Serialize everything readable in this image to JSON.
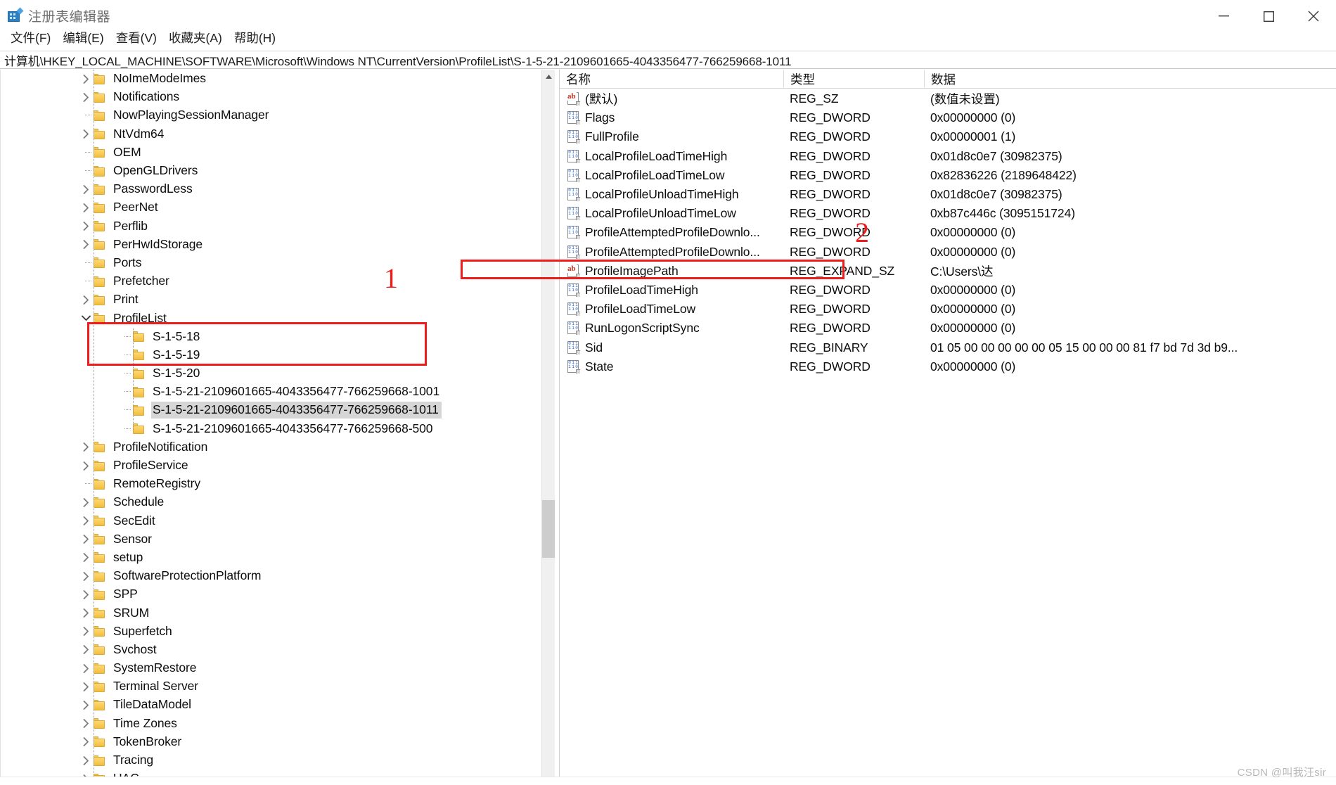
{
  "window": {
    "title": "注册表编辑器",
    "icon": "registry-editor-icon",
    "minimize_label": "—",
    "maximize_label": "□",
    "close_label": "✕"
  },
  "menu": {
    "items": [
      {
        "label": "文件(F)"
      },
      {
        "label": "编辑(E)"
      },
      {
        "label": "查看(V)"
      },
      {
        "label": "收藏夹(A)"
      },
      {
        "label": "帮助(H)"
      }
    ]
  },
  "address": {
    "path": "计算机\\HKEY_LOCAL_MACHINE\\SOFTWARE\\Microsoft\\Windows NT\\CurrentVersion\\ProfileList\\S-1-5-21-2109601665-4043356477-766259668-1011"
  },
  "tree": {
    "items": [
      {
        "label": "NoImeModeImes",
        "indent": 1,
        "expander": "collapsed",
        "selected": false
      },
      {
        "label": "Notifications",
        "indent": 1,
        "expander": "collapsed",
        "selected": false
      },
      {
        "label": "NowPlayingSessionManager",
        "indent": 1,
        "expander": "none",
        "selected": false
      },
      {
        "label": "NtVdm64",
        "indent": 1,
        "expander": "collapsed",
        "selected": false
      },
      {
        "label": "OEM",
        "indent": 1,
        "expander": "none",
        "selected": false
      },
      {
        "label": "OpenGLDrivers",
        "indent": 1,
        "expander": "none",
        "selected": false
      },
      {
        "label": "PasswordLess",
        "indent": 1,
        "expander": "collapsed",
        "selected": false
      },
      {
        "label": "PeerNet",
        "indent": 1,
        "expander": "collapsed",
        "selected": false
      },
      {
        "label": "Perflib",
        "indent": 1,
        "expander": "collapsed",
        "selected": false
      },
      {
        "label": "PerHwIdStorage",
        "indent": 1,
        "expander": "collapsed",
        "selected": false
      },
      {
        "label": "Ports",
        "indent": 1,
        "expander": "none",
        "selected": false
      },
      {
        "label": "Prefetcher",
        "indent": 1,
        "expander": "none",
        "selected": false
      },
      {
        "label": "Print",
        "indent": 1,
        "expander": "collapsed",
        "selected": false
      },
      {
        "label": "ProfileList",
        "indent": 1,
        "expander": "expanded",
        "selected": false
      },
      {
        "label": "S-1-5-18",
        "indent": 2,
        "expander": "none",
        "selected": false
      },
      {
        "label": "S-1-5-19",
        "indent": 2,
        "expander": "none",
        "selected": false
      },
      {
        "label": "S-1-5-20",
        "indent": 2,
        "expander": "none",
        "selected": false
      },
      {
        "label": "S-1-5-21-2109601665-4043356477-766259668-1001",
        "indent": 2,
        "expander": "none",
        "selected": false
      },
      {
        "label": "S-1-5-21-2109601665-4043356477-766259668-1011",
        "indent": 2,
        "expander": "none",
        "selected": true
      },
      {
        "label": "S-1-5-21-2109601665-4043356477-766259668-500",
        "indent": 2,
        "expander": "none",
        "selected": false
      },
      {
        "label": "ProfileNotification",
        "indent": 1,
        "expander": "collapsed",
        "selected": false
      },
      {
        "label": "ProfileService",
        "indent": 1,
        "expander": "collapsed",
        "selected": false
      },
      {
        "label": "RemoteRegistry",
        "indent": 1,
        "expander": "none",
        "selected": false
      },
      {
        "label": "Schedule",
        "indent": 1,
        "expander": "collapsed",
        "selected": false
      },
      {
        "label": "SecEdit",
        "indent": 1,
        "expander": "collapsed",
        "selected": false
      },
      {
        "label": "Sensor",
        "indent": 1,
        "expander": "collapsed",
        "selected": false
      },
      {
        "label": "setup",
        "indent": 1,
        "expander": "collapsed",
        "selected": false
      },
      {
        "label": "SoftwareProtectionPlatform",
        "indent": 1,
        "expander": "collapsed",
        "selected": false
      },
      {
        "label": "SPP",
        "indent": 1,
        "expander": "collapsed",
        "selected": false
      },
      {
        "label": "SRUM",
        "indent": 1,
        "expander": "collapsed",
        "selected": false
      },
      {
        "label": "Superfetch",
        "indent": 1,
        "expander": "collapsed",
        "selected": false
      },
      {
        "label": "Svchost",
        "indent": 1,
        "expander": "collapsed",
        "selected": false
      },
      {
        "label": "SystemRestore",
        "indent": 1,
        "expander": "collapsed",
        "selected": false
      },
      {
        "label": "Terminal Server",
        "indent": 1,
        "expander": "collapsed",
        "selected": false
      },
      {
        "label": "TileDataModel",
        "indent": 1,
        "expander": "collapsed",
        "selected": false
      },
      {
        "label": "Time Zones",
        "indent": 1,
        "expander": "collapsed",
        "selected": false
      },
      {
        "label": "TokenBroker",
        "indent": 1,
        "expander": "collapsed",
        "selected": false
      },
      {
        "label": "Tracing",
        "indent": 1,
        "expander": "collapsed",
        "selected": false
      },
      {
        "label": "UAC",
        "indent": 1,
        "expander": "collapsed",
        "selected": false
      }
    ]
  },
  "values": {
    "columns": {
      "name": "名称",
      "type": "类型",
      "data": "数据"
    },
    "rows": [
      {
        "name": "(默认)",
        "icon": "string-value-icon",
        "type": "REG_SZ",
        "data": "(数值未设置)"
      },
      {
        "name": "Flags",
        "icon": "dword-value-icon",
        "type": "REG_DWORD",
        "data": "0x00000000 (0)"
      },
      {
        "name": "FullProfile",
        "icon": "dword-value-icon",
        "type": "REG_DWORD",
        "data": "0x00000001 (1)"
      },
      {
        "name": "LocalProfileLoadTimeHigh",
        "icon": "dword-value-icon",
        "type": "REG_DWORD",
        "data": "0x01d8c0e7 (30982375)"
      },
      {
        "name": "LocalProfileLoadTimeLow",
        "icon": "dword-value-icon",
        "type": "REG_DWORD",
        "data": "0x82836226 (2189648422)"
      },
      {
        "name": "LocalProfileUnloadTimeHigh",
        "icon": "dword-value-icon",
        "type": "REG_DWORD",
        "data": "0x01d8c0e7 (30982375)"
      },
      {
        "name": "LocalProfileUnloadTimeLow",
        "icon": "dword-value-icon",
        "type": "REG_DWORD",
        "data": "0xb87c446c (3095151724)"
      },
      {
        "name": "ProfileAttemptedProfileDownlo...",
        "icon": "dword-value-icon",
        "type": "REG_DWORD",
        "data": "0x00000000 (0)"
      },
      {
        "name": "ProfileAttemptedProfileDownlo...",
        "icon": "dword-value-icon",
        "type": "REG_DWORD",
        "data": "0x00000000 (0)"
      },
      {
        "name": "ProfileImagePath",
        "icon": "string-value-icon",
        "type": "REG_EXPAND_SZ",
        "data": "C:\\Users\\达"
      },
      {
        "name": "ProfileLoadTimeHigh",
        "icon": "dword-value-icon",
        "type": "REG_DWORD",
        "data": "0x00000000 (0)"
      },
      {
        "name": "ProfileLoadTimeLow",
        "icon": "dword-value-icon",
        "type": "REG_DWORD",
        "data": "0x00000000 (0)"
      },
      {
        "name": "RunLogonScriptSync",
        "icon": "dword-value-icon",
        "type": "REG_DWORD",
        "data": "0x00000000 (0)"
      },
      {
        "name": "Sid",
        "icon": "binary-value-icon",
        "type": "REG_BINARY",
        "data": "01 05 00 00 00 00 00 05 15 00 00 00 81 f7 bd 7d 3d b9..."
      },
      {
        "name": "State",
        "icon": "dword-value-icon",
        "type": "REG_DWORD",
        "data": "0x00000000 (0)"
      }
    ]
  },
  "annotations": {
    "marker_tree": "1",
    "marker_value": "2",
    "color": "#ef1c1c"
  },
  "watermark": {
    "text": "CSDN @叫我汪sir"
  }
}
